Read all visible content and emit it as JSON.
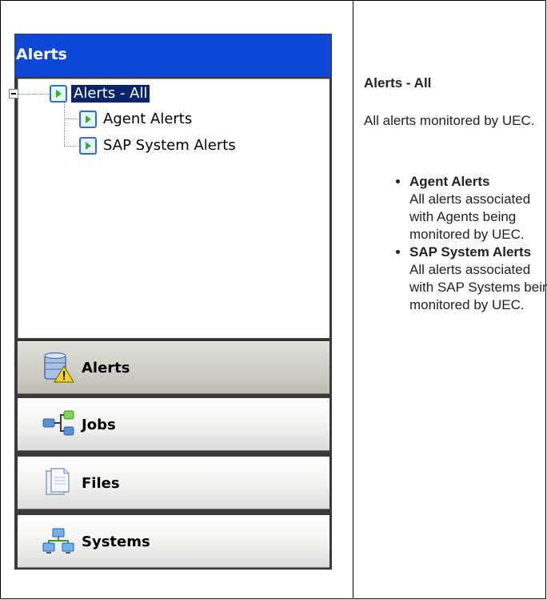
{
  "nav_pane": {
    "header": "Alerts",
    "tree": [
      {
        "label": "Alerts - All",
        "selected": true,
        "icon": "alert-view-icon"
      },
      {
        "label": "Agent Alerts",
        "selected": false,
        "icon": "alert-view-icon"
      },
      {
        "label": "SAP System Alerts",
        "selected": false,
        "icon": "alert-view-icon"
      }
    ],
    "buttons": [
      {
        "label": "Alerts",
        "icon": "alerts-database-icon",
        "active": true
      },
      {
        "label": "Jobs",
        "icon": "jobs-network-icon",
        "active": false
      },
      {
        "label": "Files",
        "icon": "files-document-icon",
        "active": false
      },
      {
        "label": "Systems",
        "icon": "systems-computers-icon",
        "active": false
      }
    ],
    "colors": {
      "header_bg": "#0c47d8",
      "selection_bg": "#0a246a"
    }
  },
  "description": {
    "title": "Alerts - All",
    "text": "All alerts monitored by UEC.",
    "items": [
      {
        "name": "Agent Alerts",
        "text": "All alerts associated with Agents being monitored by UEC."
      },
      {
        "name": "SAP System Alerts",
        "text": "All alerts associated with SAP Systems being monitored by UEC."
      }
    ]
  }
}
